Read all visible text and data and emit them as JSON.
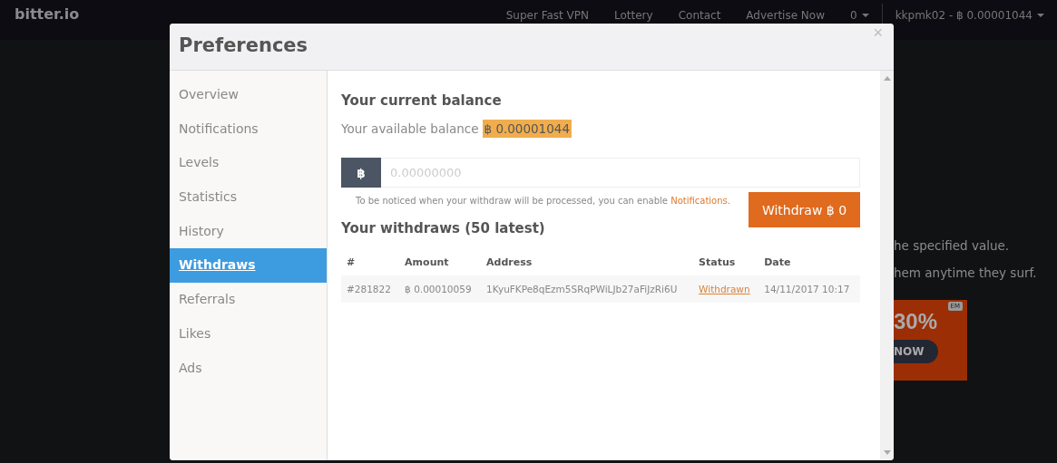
{
  "navbar": {
    "logo": "bitter.io",
    "links": [
      "Super Fast VPN",
      "Lottery",
      "Contact",
      "Advertise Now"
    ],
    "count_menu": "0",
    "account_menu": "kkpmk02 - ฿ 0.00001044"
  },
  "background": {
    "lines": [
      "he specified value.",
      "hem anytime they surf."
    ],
    "ad": {
      "headline": "30%",
      "button": "NOW",
      "tag": "EM"
    }
  },
  "modal": {
    "title": "Preferences",
    "close": "×",
    "sidebar": {
      "items": [
        {
          "label": "Overview",
          "selected": false
        },
        {
          "label": "Notifications",
          "selected": false
        },
        {
          "label": "Levels",
          "selected": false
        },
        {
          "label": "Statistics",
          "selected": false
        },
        {
          "label": "History",
          "selected": false
        },
        {
          "label": "Withdraws",
          "selected": true
        },
        {
          "label": "Referrals",
          "selected": false
        },
        {
          "label": "Likes",
          "selected": false
        },
        {
          "label": "Ads",
          "selected": false
        }
      ]
    },
    "balance": {
      "heading": "Your current balance",
      "label": "Your available balance",
      "value": "฿ 0.00001044"
    },
    "withdraw": {
      "addon": "฿",
      "placeholder": "0.00000000",
      "hint": "To be noticed when your withdraw will be processed, you can enable ",
      "hint_link": "Notifications",
      "hint_end": ".",
      "button": "Withdraw ฿ 0"
    },
    "table": {
      "heading": "Your withdraws (50 latest)",
      "columns": [
        "#",
        "Amount",
        "Address",
        "Status",
        "Date"
      ],
      "rows": [
        {
          "id": "#281822",
          "amount": "฿ 0.00010059",
          "address": "1KyuFKPe8qEzm5SRqPWiLJb27aFiJzRi6U",
          "status": "Withdrawn",
          "date": "14/11/2017 10:17"
        }
      ]
    }
  }
}
